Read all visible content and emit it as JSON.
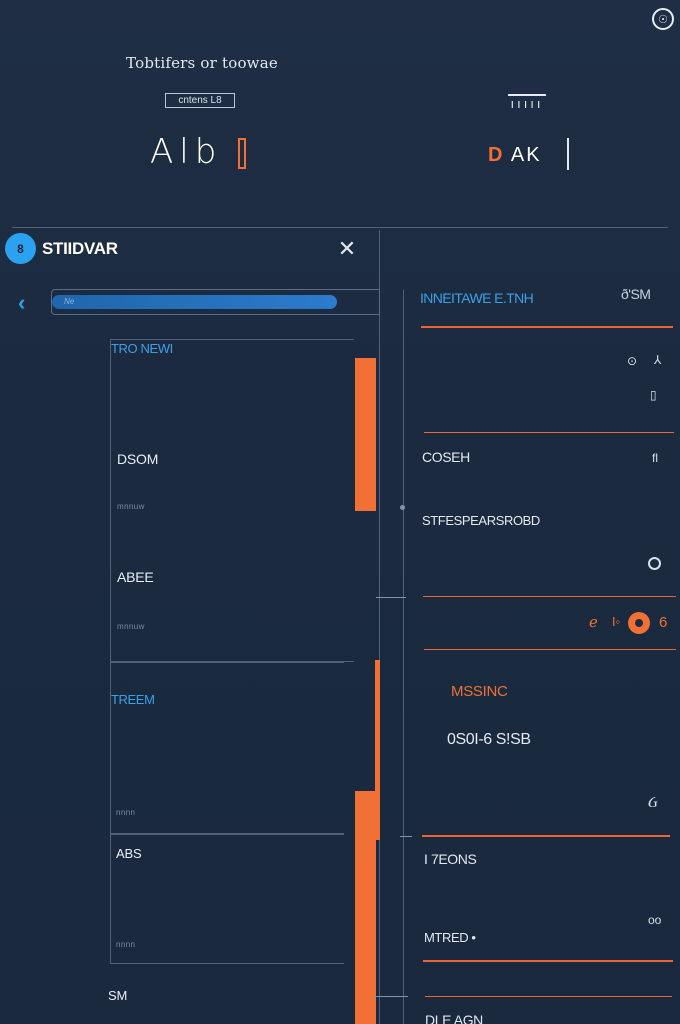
{
  "top": {
    "corner_icon": "☉",
    "heading": "Tobtifers or toowae",
    "chip": "cntens L8",
    "big_left": "Alb",
    "mini_icon": "ııııı",
    "big_right_first": "D",
    "big_right_rest": "AK"
  },
  "panel": {
    "avatar": "8",
    "title": "STIIDVAR",
    "close_icon": "✕"
  },
  "left": {
    "back_icon": "‹",
    "search_text": "Ne",
    "sections": [
      {
        "label": "TRO NEWI"
      },
      {
        "label": "TREEM"
      }
    ],
    "rows": [
      {
        "label": "DSOM",
        "meta": "mnnuw"
      },
      {
        "label": "ABEE",
        "meta": "mnnuw"
      },
      {
        "label": "ABS",
        "meta": "nnnn"
      },
      {
        "label": "SM",
        "meta": ""
      }
    ],
    "tree_meta": "nnnn"
  },
  "right": {
    "header": "INNEITAWE E.TNH",
    "header_right": "ð'SM",
    "icons_row1": [
      "⊙",
      "⅄"
    ],
    "icon_row1b": "▯",
    "item1_title": "COSEH",
    "item1_icon": "fl",
    "item2_title": "STFESPEARSROBD",
    "item2_icon": "○",
    "nav_left": "ℯ",
    "nav_mid": "I◦",
    "nav_right": "6",
    "accent_label": "MSSINC",
    "item3_text": "0S0I-6 S!SB",
    "item3_icon": "Ᏽ",
    "item4_title": "I 7EONS",
    "item4_icon": "oo",
    "item5_title": "MTRED •",
    "item6_title": "DLE AGN"
  },
  "colors": {
    "background": "#1c2b40",
    "accent_orange": "#f07035",
    "accent_blue": "#2aa2f0",
    "divider": "#4e6179"
  }
}
